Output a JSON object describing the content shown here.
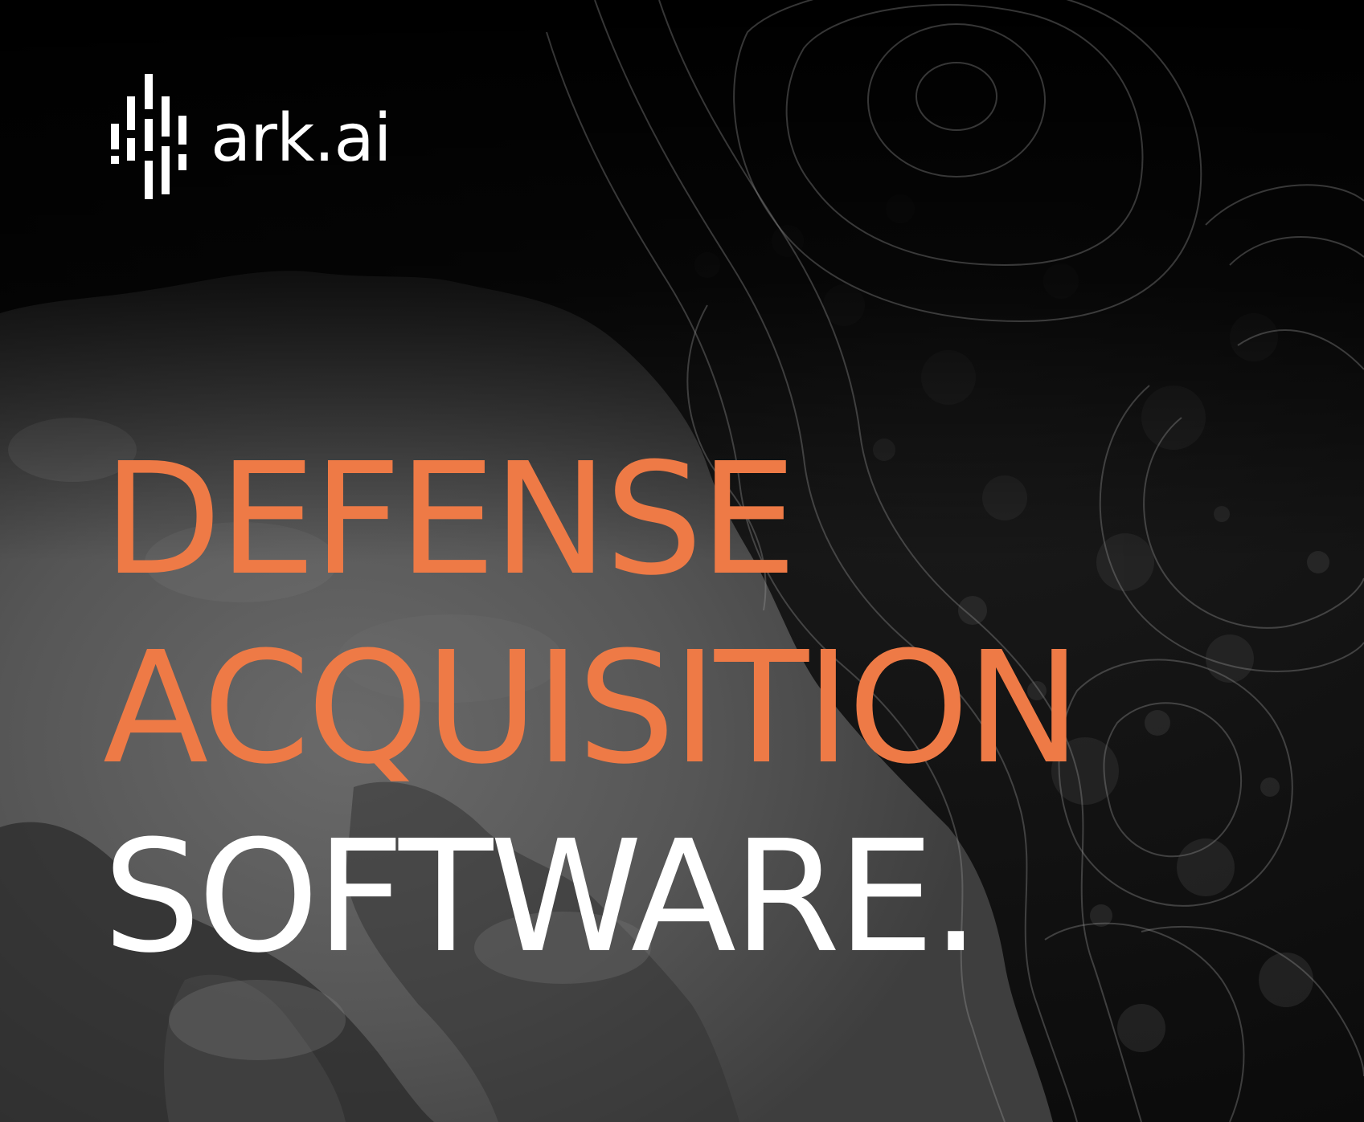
{
  "brand": {
    "name": "ark.ai",
    "logo_icon": "bar-grid-logo-icon"
  },
  "headline": {
    "line1": "DEFENSE",
    "line2": "ACQUISITION",
    "line3": "SOFTWARE."
  },
  "colors": {
    "accent": "#ee7a46",
    "text_light": "#ffffff",
    "background": "#060606",
    "water": "#5a5a5a"
  }
}
